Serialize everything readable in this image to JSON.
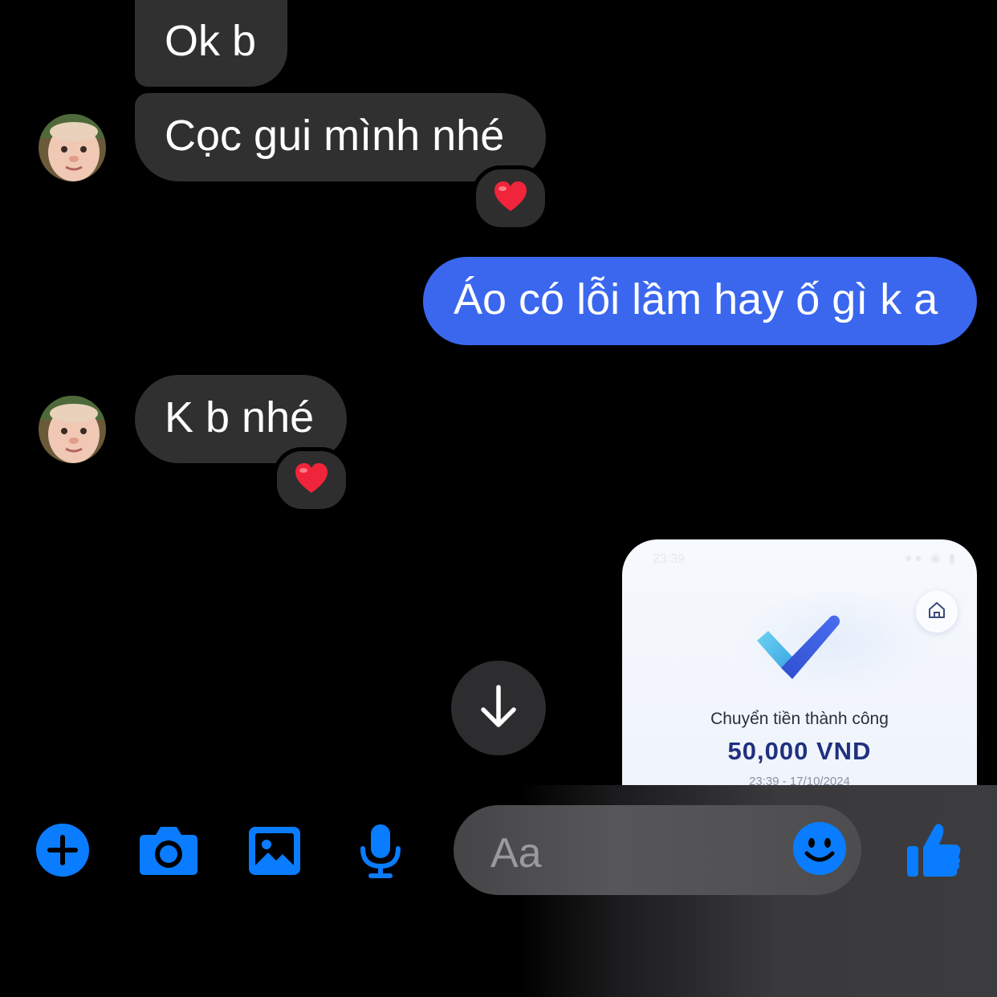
{
  "messages": [
    {
      "text": "Ok b",
      "direction": "received"
    },
    {
      "text": "Cọc gui mình nhé",
      "direction": "received",
      "reaction": "heart"
    },
    {
      "text": "Áo có lỗi lầm hay ố gì k a",
      "direction": "sent"
    },
    {
      "text": "K b nhé",
      "direction": "received",
      "reaction": "heart"
    }
  ],
  "receipt": {
    "status_time": "23:39",
    "title": "Chuyển tiền thành công",
    "amount": "50,000 VND",
    "datetime": "23:39 - 17/10/2024"
  },
  "composer": {
    "placeholder": "Aa",
    "icons": [
      "plus-icon",
      "camera-icon",
      "gallery-icon",
      "microphone-icon",
      "emoji-icon",
      "thumbs-up-icon"
    ]
  },
  "colors": {
    "accent": "#0a7cff",
    "sent_bubble": "#3a67ee",
    "received_bubble": "#303030",
    "background": "#000000"
  }
}
